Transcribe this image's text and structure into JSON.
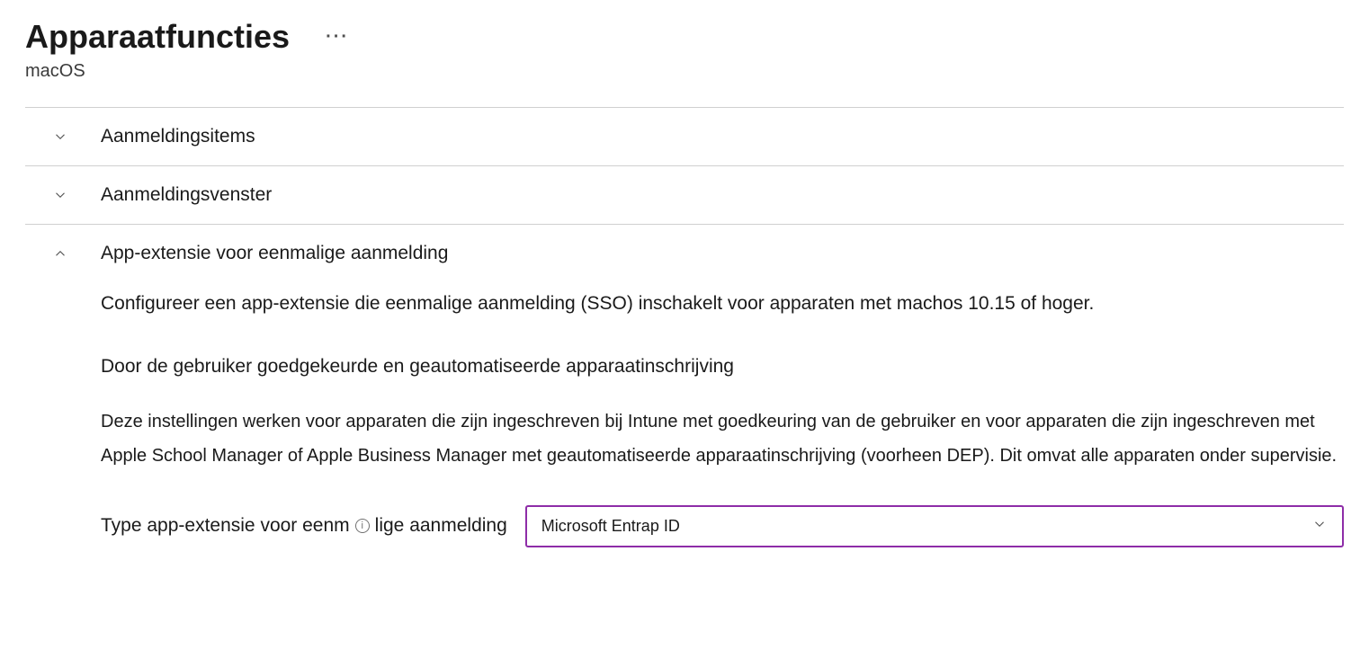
{
  "header": {
    "title": "Apparaatfuncties",
    "subtitle": "macOS"
  },
  "sections": {
    "login_items": {
      "label": "Aanmeldingsitems"
    },
    "login_window": {
      "label": "Aanmeldingsvenster"
    },
    "sso_extension": {
      "label": "App-extensie voor eenmalige aanmelding",
      "description": "Configureer een app-extensie die eenmalige aanmelding (SSO) inschakelt voor apparaten met machos 10.15 of hoger.",
      "enrollment_heading": "Door de gebruiker goedgekeurde en geautomatiseerde apparaatinschrijving",
      "enrollment_text": "Deze instellingen werken voor apparaten die zijn ingeschreven bij    Intune met goedkeuring van de gebruiker en voor apparaten die zijn ingeschreven met Apple School Manager of Apple Business Manager met geautomatiseerde apparaatinschrijving (voorheen DEP). Dit omvat alle apparaten onder supervisie.",
      "type_label_before": "Type app-extensie voor eenm",
      "type_label_after": "lige aanmelding",
      "type_value": "Microsoft Entrap        ID"
    }
  }
}
